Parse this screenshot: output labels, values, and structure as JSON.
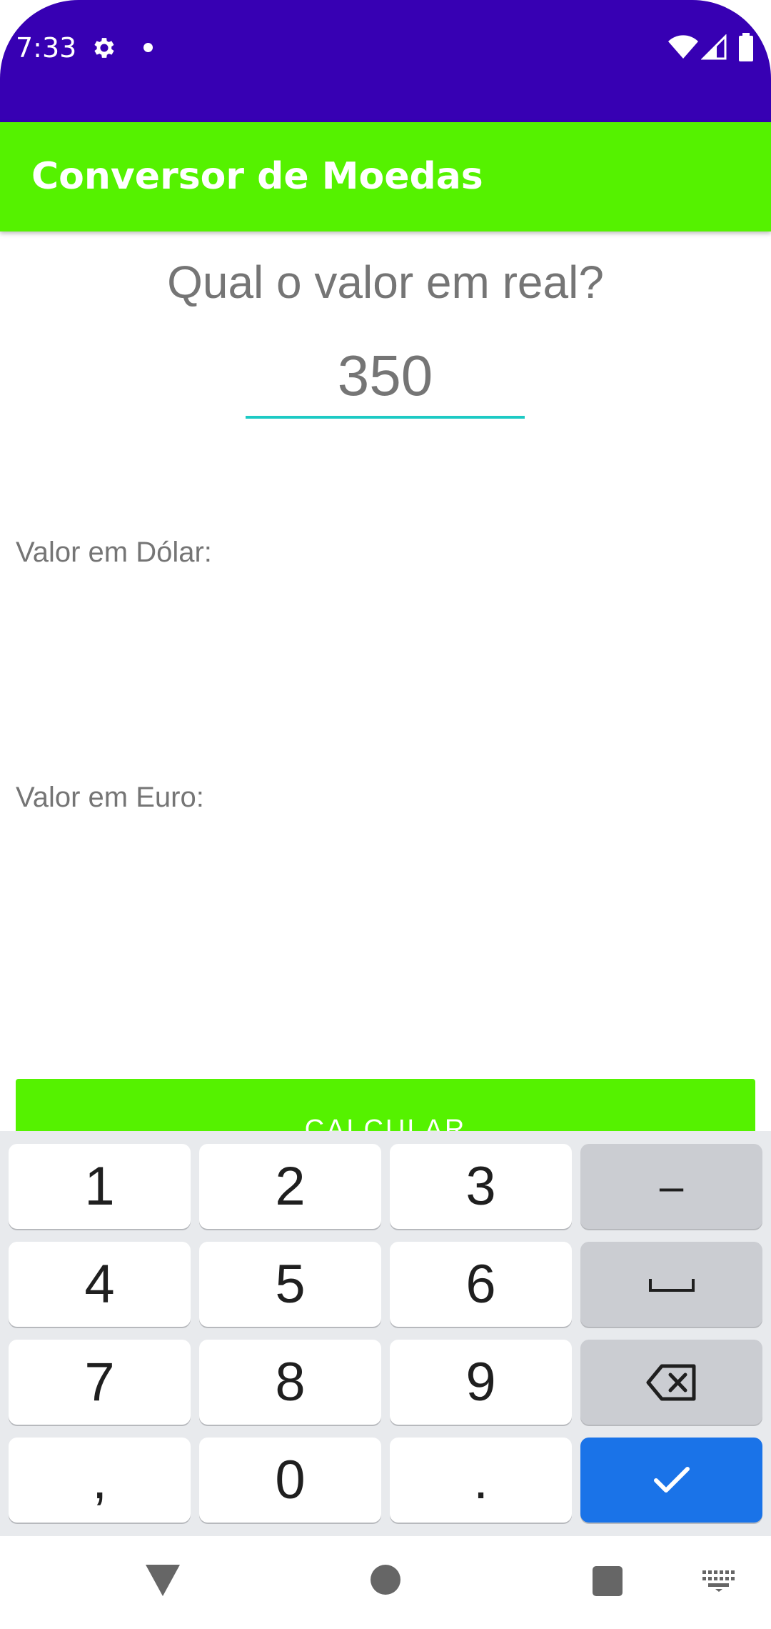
{
  "status_bar": {
    "time": "7:33",
    "icons": [
      "gear-icon",
      "notification-dot-icon",
      "wifi-icon",
      "signal-icon",
      "battery-icon"
    ],
    "background": "#3700b3"
  },
  "app_bar": {
    "title": "Conversor de Moedas",
    "background": "#55f200"
  },
  "main": {
    "question": "Qual o valor em real?",
    "input_value": "350",
    "label_dolar": "Valor em Dólar:",
    "label_euro": "Valor em Euro:",
    "calculate_button": "CALCULAR",
    "accent_color": "#1dcac4"
  },
  "keyboard": {
    "keys": {
      "k1": "1",
      "k2": "2",
      "k3": "3",
      "minus": "–",
      "k4": "4",
      "k5": "5",
      "k6": "6",
      "k7": "7",
      "k8": "8",
      "k9": "9",
      "comma": ",",
      "k0": "0",
      "period": "."
    },
    "icons": [
      "space-icon",
      "backspace-icon",
      "checkmark-icon"
    ],
    "done_color": "#1a73e8"
  },
  "nav_bar": {
    "icons": [
      "back-icon",
      "home-icon",
      "recents-icon",
      "keyboard-switch-icon"
    ]
  }
}
